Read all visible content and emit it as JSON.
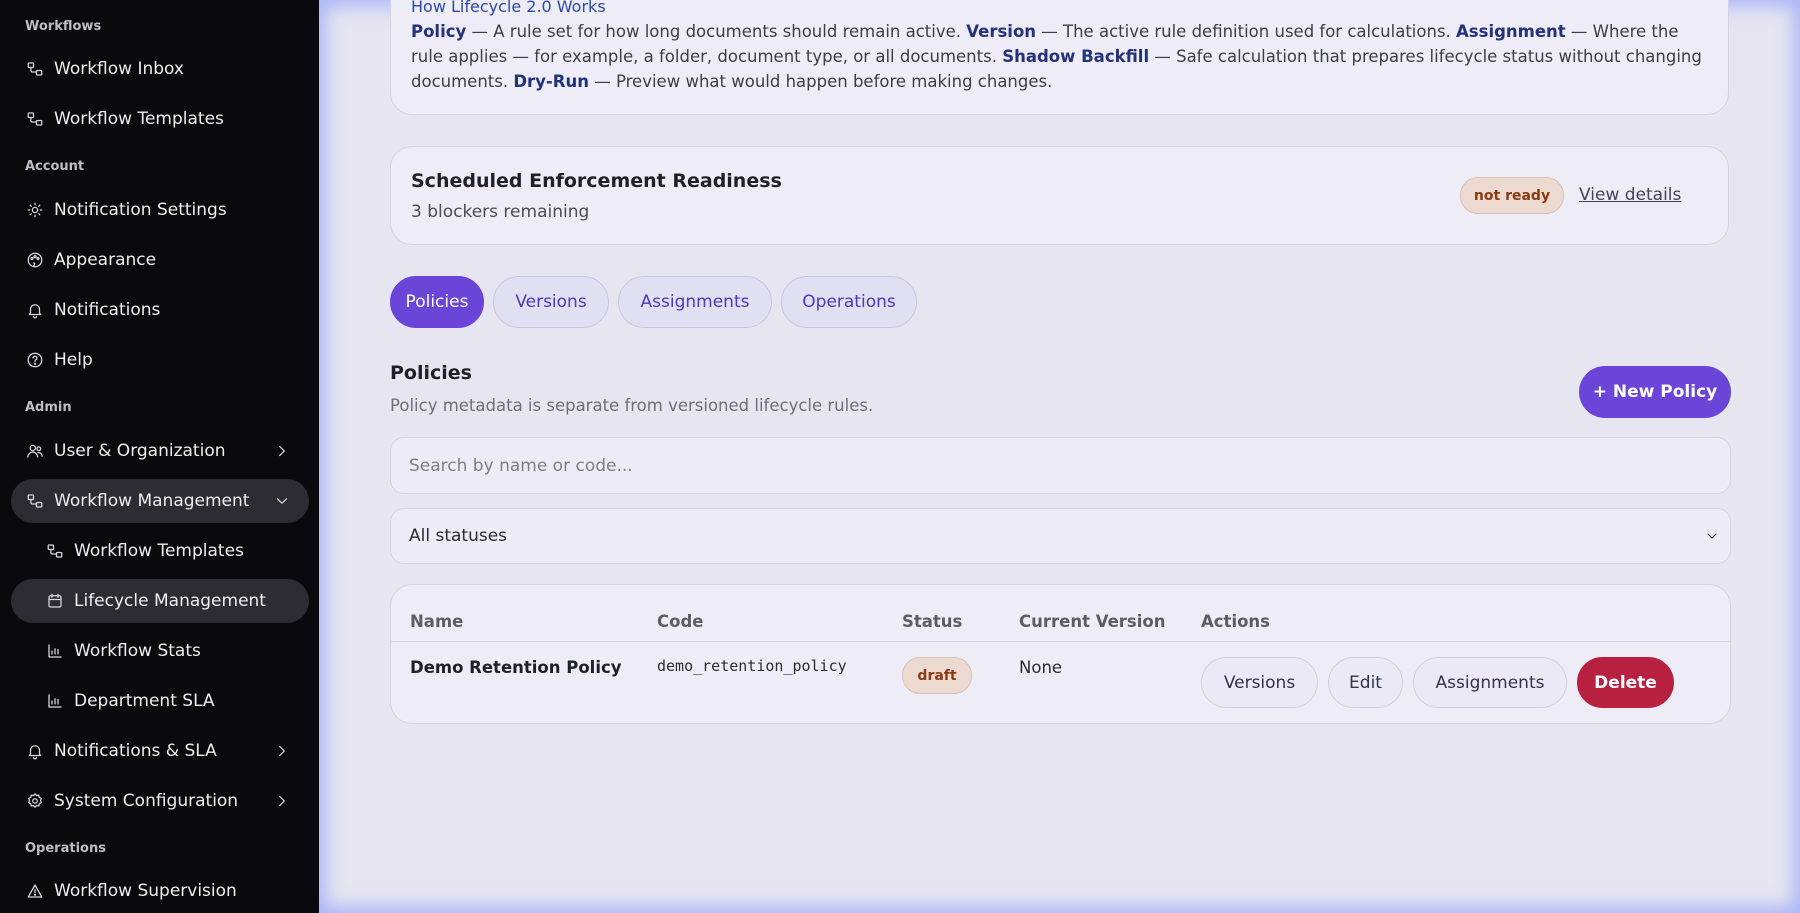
{
  "sidebar": {
    "sections": {
      "workflows": "Workflows",
      "account": "Account",
      "admin": "Admin",
      "operations": "Operations"
    },
    "items": [
      {
        "label": "Workflow Inbox",
        "icon": "workflow-icon"
      },
      {
        "label": "Workflow Templates",
        "icon": "workflow-icon"
      },
      {
        "label": "Notification Settings",
        "icon": "sun-icon"
      },
      {
        "label": "Appearance",
        "icon": "palette-icon"
      },
      {
        "label": "Notifications",
        "icon": "bell-icon"
      },
      {
        "label": "Help",
        "icon": "help-circle-icon"
      },
      {
        "label": "User & Organization",
        "icon": "users-icon"
      },
      {
        "label": "Workflow Management",
        "icon": "workflow-icon"
      },
      {
        "label": "Workflow Templates",
        "icon": "workflow-icon"
      },
      {
        "label": "Lifecycle Management",
        "icon": "calendar-icon"
      },
      {
        "label": "Workflow Stats",
        "icon": "bar-chart-icon"
      },
      {
        "label": "Department SLA",
        "icon": "bar-chart-icon"
      },
      {
        "label": "Notifications & SLA",
        "icon": "bell-icon"
      },
      {
        "label": "System Configuration",
        "icon": "gear-icon"
      },
      {
        "label": "Workflow Supervision",
        "icon": "warning-triangle-icon"
      }
    ]
  },
  "info": {
    "title": "How Lifecycle 2.0 Works",
    "policy_term": "Policy",
    "policy_desc": " — A rule set for how long documents should remain active. ",
    "version_term": "Version",
    "version_desc": " — The active rule definition used for calculations. ",
    "assignment_term": "Assignment",
    "assignment_desc": " — Where the rule applies — for example, a folder, document type, or all documents. ",
    "shadow_term": "Shadow Backfill",
    "shadow_desc": " — Safe calculation that prepares lifecycle status without changing documents. ",
    "dryrun_term": "Dry-Run",
    "dryrun_desc": " — Preview what would happen before making changes."
  },
  "readiness": {
    "title": "Scheduled Enforcement Readiness",
    "subtitle": "3 blockers remaining",
    "badge": "not ready",
    "link": "View details"
  },
  "tabs": [
    {
      "label": "Policies",
      "active": true
    },
    {
      "label": "Versions",
      "active": false
    },
    {
      "label": "Assignments",
      "active": false
    },
    {
      "label": "Operations",
      "active": false
    }
  ],
  "policies": {
    "title": "Policies",
    "subtitle": "Policy metadata is separate from versioned lifecycle rules.",
    "new_button": "+ New Policy",
    "search_placeholder": "Search by name or code...",
    "status_filter": "All statuses"
  },
  "table": {
    "headers": [
      "Name",
      "Code",
      "Status",
      "Current Version",
      "Actions"
    ],
    "rows": [
      {
        "name": "Demo Retention Policy",
        "code": "demo_retention_policy",
        "status": "draft",
        "current_version": "None",
        "actions": [
          "Versions",
          "Edit",
          "Assignments",
          "Delete"
        ]
      }
    ]
  },
  "colors": {
    "accent": "#6a45d8",
    "danger": "#b8203f",
    "badge_text": "#8a3a12"
  }
}
